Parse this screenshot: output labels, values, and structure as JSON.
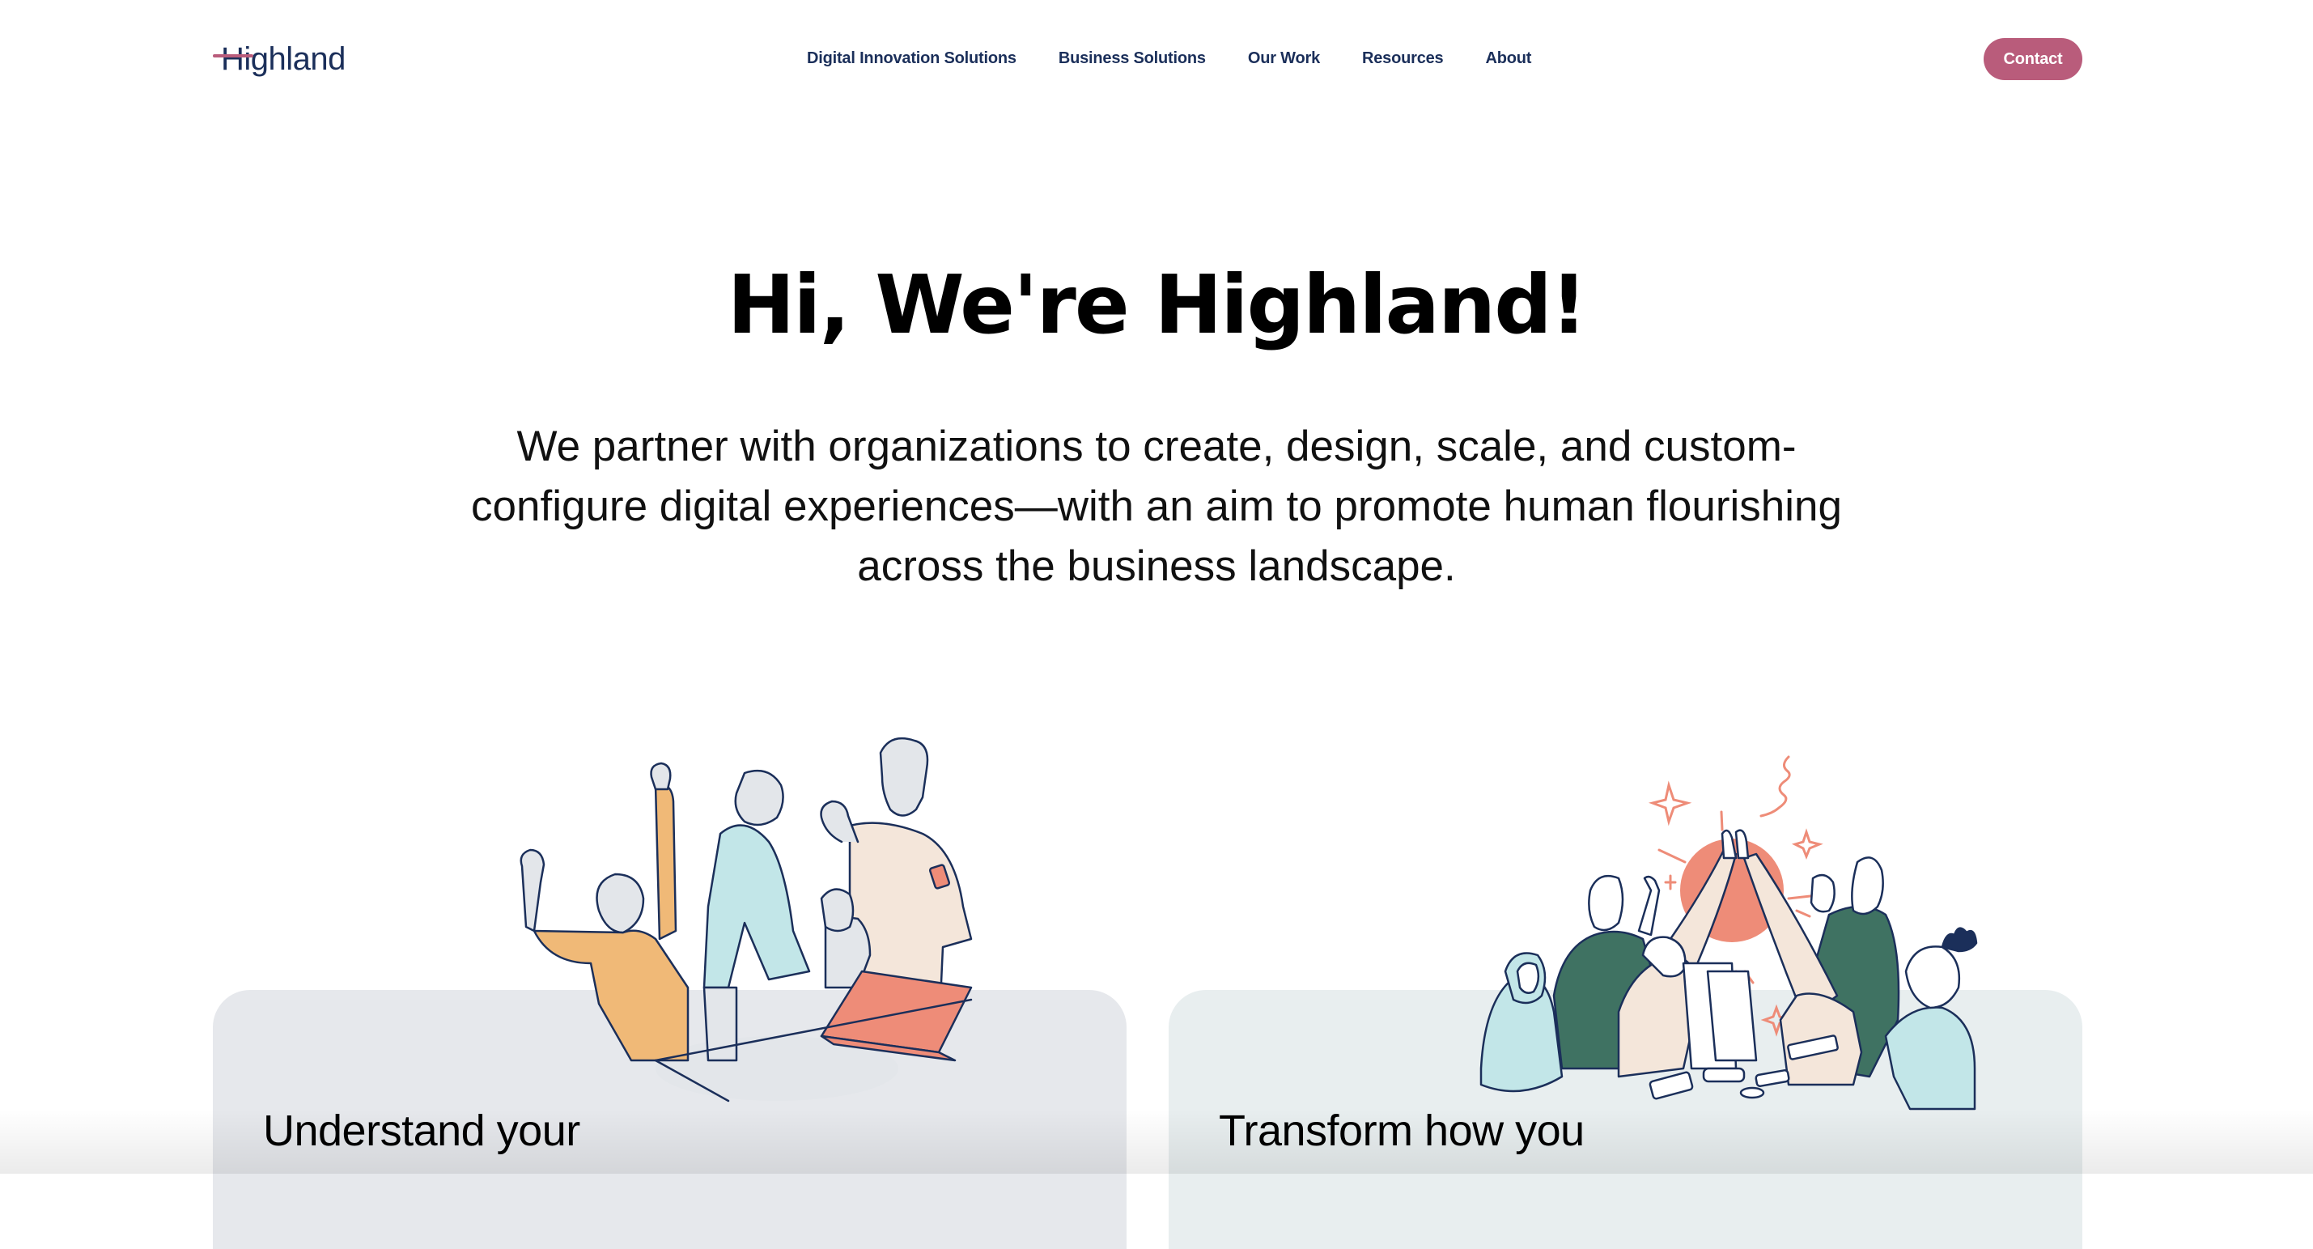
{
  "header": {
    "logo_text": "Highland",
    "nav": [
      {
        "label": "Digital Innovation Solutions"
      },
      {
        "label": "Business Solutions"
      },
      {
        "label": "Our Work"
      },
      {
        "label": "Resources"
      },
      {
        "label": "About"
      }
    ],
    "contact_label": "Contact"
  },
  "hero": {
    "title": "Hi, We're Highland!",
    "subtitle": "We partner with organizations to create, design, scale, and custom-configure digital experiences—with an aim to promote human flourishing across the business landscape."
  },
  "cards": [
    {
      "heading": "Understand your",
      "illustration": "team-celebrating-at-laptop"
    },
    {
      "heading": "Transform how you",
      "illustration": "team-high-five"
    }
  ],
  "colors": {
    "brand_navy": "#1b2f5a",
    "brand_pink": "#b95c7b",
    "card1_bg": "#e6e8ec",
    "card2_bg": "#e8eeef",
    "accent_coral": "#ee8c78",
    "accent_orange": "#f0b977",
    "accent_teal": "#c2e6e8",
    "accent_green": "#3f7262",
    "accent_beige": "#f4e6da"
  }
}
